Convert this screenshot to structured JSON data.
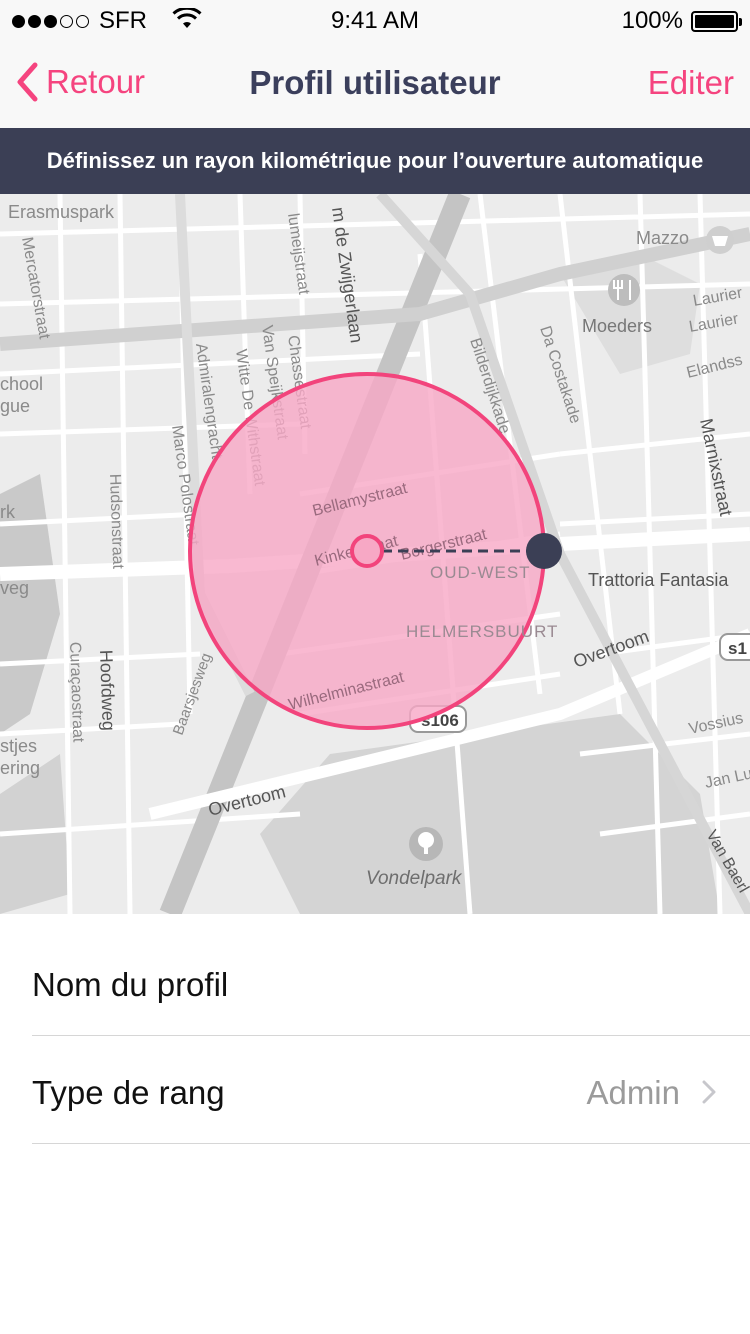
{
  "status_bar": {
    "carrier": "SFR",
    "time": "9:41 AM",
    "battery": "100%",
    "signal_bars": [
      true,
      true,
      true,
      false,
      false
    ]
  },
  "nav": {
    "back_label": "Retour",
    "title": "Profil utilisateur",
    "edit_label": "Editer",
    "accent_color": "#f5447f"
  },
  "banner": {
    "text": "Définissez un rayon kilométrique pour l’ouverture automatique"
  },
  "map": {
    "labels": {
      "erasmuspark": "Erasmuspark",
      "mercatorstraat": "Mercatorstraat",
      "school": "chool",
      "gue": "gue",
      "rk": "rk",
      "veg": "veg",
      "stjes": "stjes",
      "ering": "ering",
      "hoofdweg": "Hoofdweg",
      "curacaostraat": "Curaçaostraat",
      "hudsonstraat": "Hudsonstraat",
      "marco_polostraat": "Marco Polostraat",
      "admiralengracht": "Admiralengracht",
      "witte_de_withstraat": "Witte De Withstraat",
      "van_speijkstraat": "Van Speijkstraat",
      "chasestraat": "Chassestraat",
      "bellamystraat": "Bellamystraat",
      "kinkerstraat": "Kinkerstraat",
      "borgerstraat": "Borgerstraat",
      "oud_west": "OUD-WEST",
      "helmersbuurt": "HELMERSBUURT",
      "wilhelminastraat": "Wilhelminastraat",
      "baarsjesweg": "Baarsjesweg",
      "overtoom_1": "Overtoom",
      "overtoom_2": "Overtoom",
      "s106": "s106",
      "s1": "s1",
      "vondelpark": "Vondelpark",
      "zwiggerlaan": "m de Zwijgerlaan",
      "lumeijstraat": "lumeijstraat",
      "bilderdijkkade": "Bilderdijkkade",
      "da_costakade": "Da Costakade",
      "mazzo": "Mazzo",
      "moeders": "Moeders",
      "lauriergracht_1": "Laurier",
      "lauriergracht_2": "Laurier",
      "elandsstraat": "Elandss",
      "marnixstraat": "Marnixstraat",
      "trattoria": "Trattoria Fantasia",
      "vossius": "Vossius",
      "jan_lu": "Jan Lu",
      "van_baerle": "Van Baerl"
    },
    "radius_fill": "#f7a8c5",
    "radius_stroke": "#f2447c",
    "handle_color": "#3b3f55"
  },
  "list": {
    "profile_name_label": "Nom du profil",
    "rank_type_label": "Type de rang",
    "rank_type_value": "Admin"
  }
}
